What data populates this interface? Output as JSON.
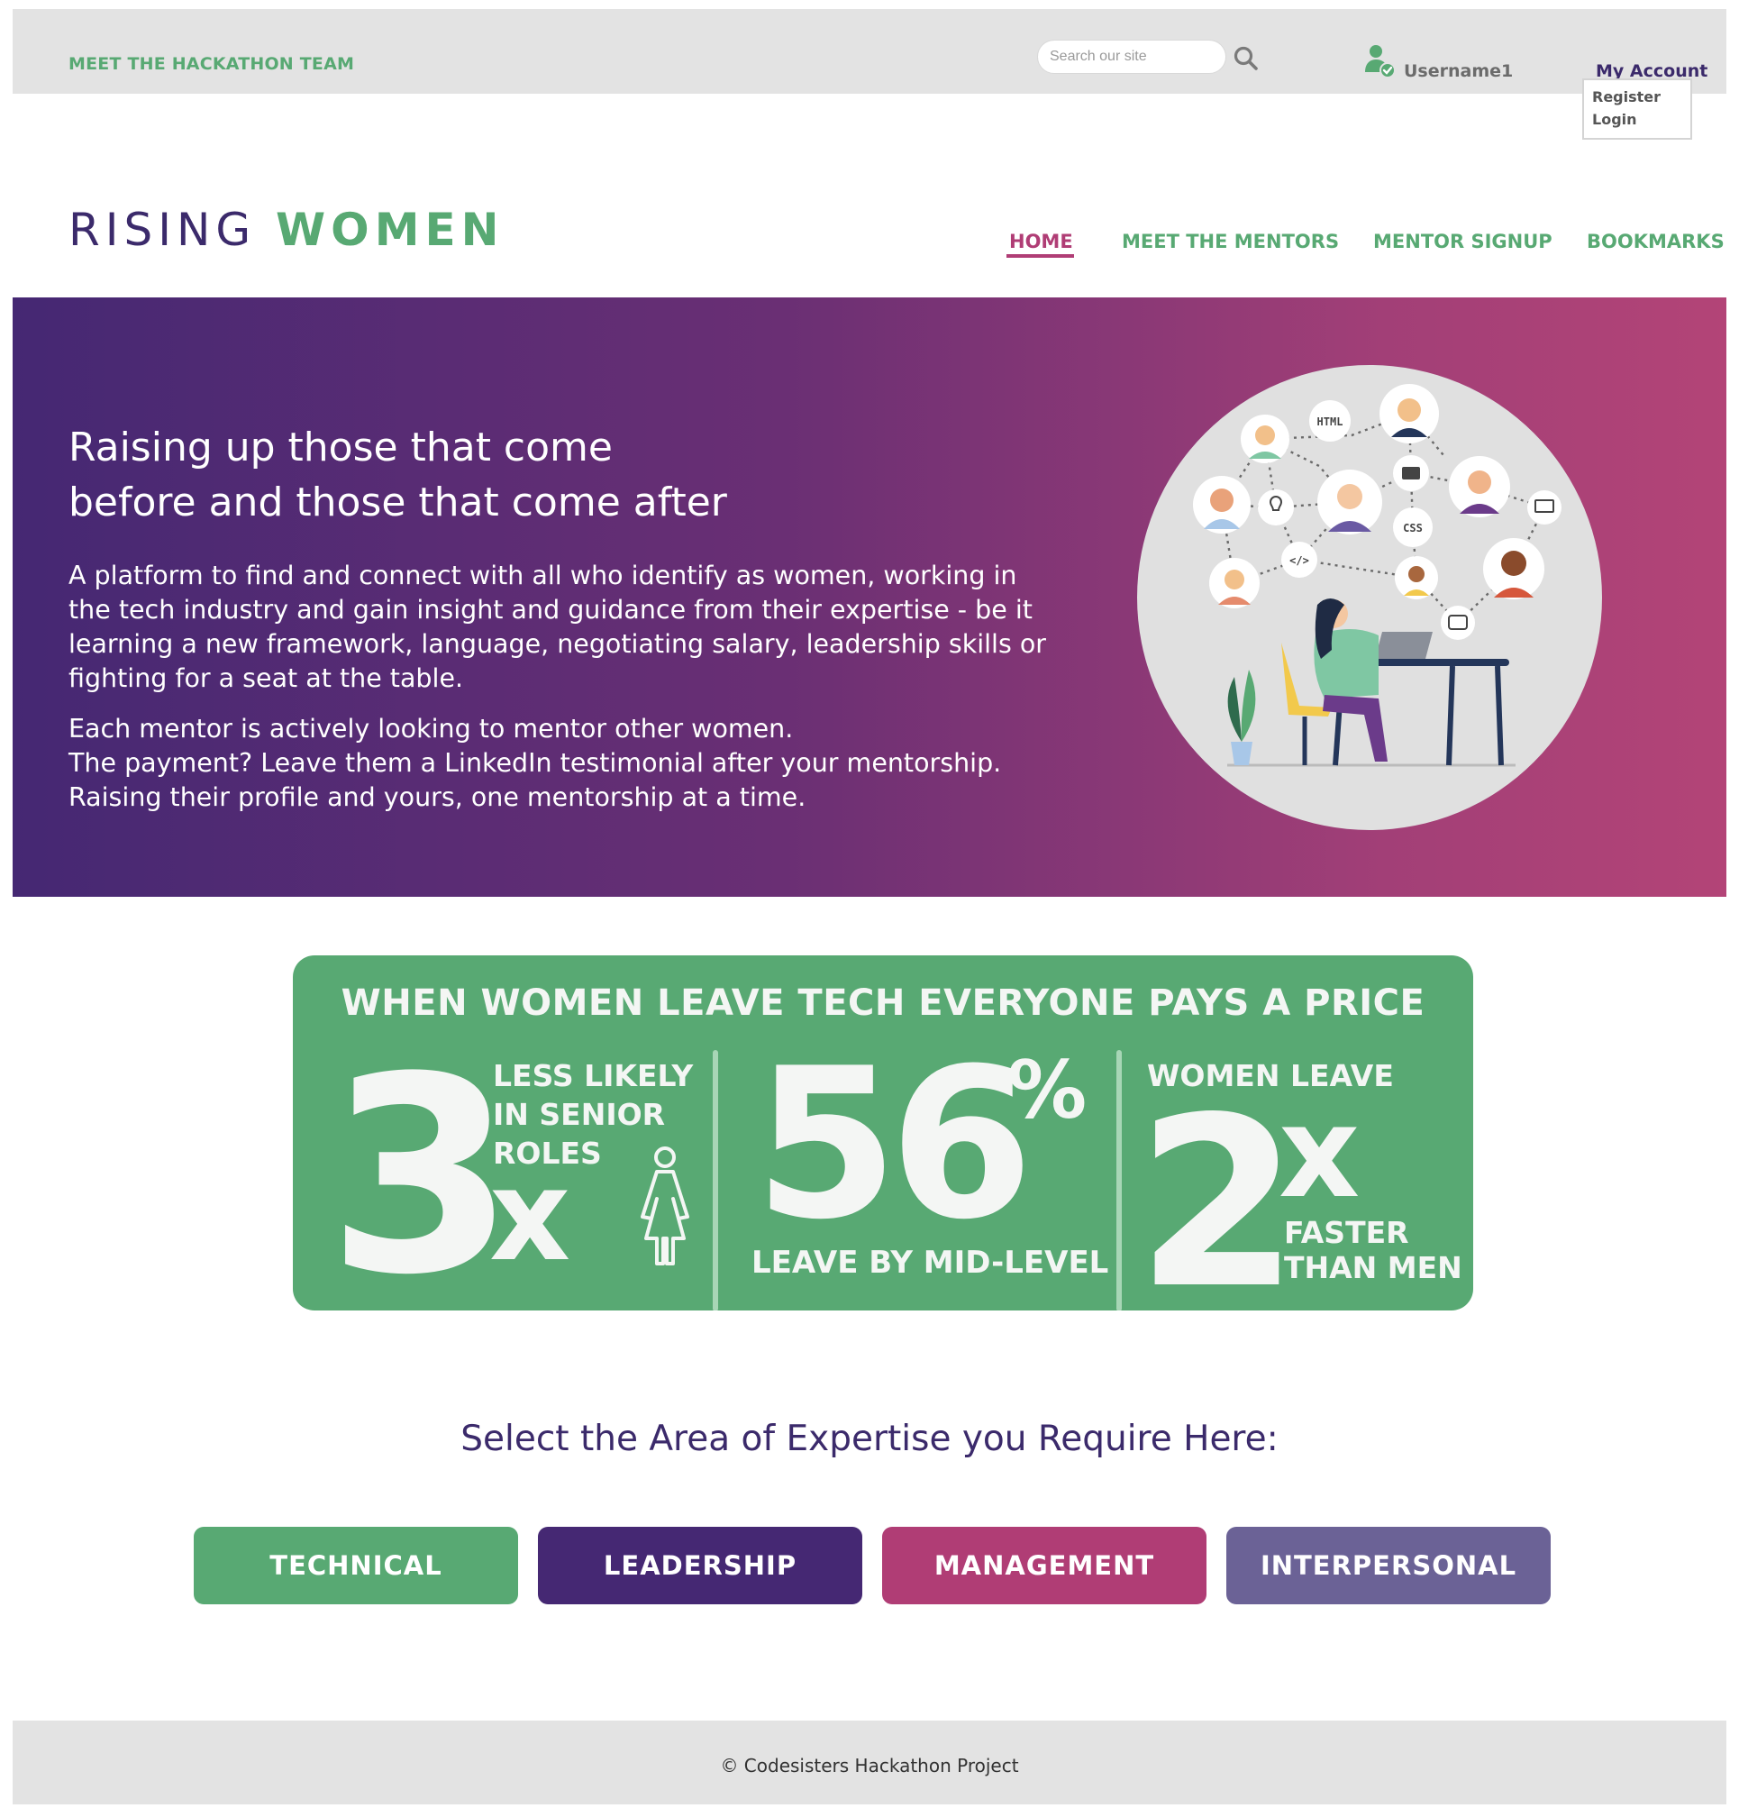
{
  "topbar": {
    "team_link": "MEET THE HACKATHON TEAM",
    "search_placeholder": "Search our site",
    "username": "Username1",
    "account_label": "My Account",
    "account_menu": [
      "Register",
      "Login"
    ]
  },
  "header": {
    "logo_part1": "RISING",
    "logo_part2": "WOMEN",
    "nav": [
      "HOME",
      "MEET THE MENTORS",
      "MENTOR SIGNUP",
      "BOOKMARKS"
    ],
    "active_nav": "HOME"
  },
  "hero": {
    "title_line1": "Raising up those that come",
    "title_line2": "before and those that come after",
    "paragraph1": "A platform to find and connect with all who identify as women, working in the tech industry and gain insight and guidance from their expertise - be it learning a new framework, language, negotiating salary, leadership skills or fighting for a seat at the table.",
    "paragraph2": "Each mentor is actively looking to mentor other women.\nThe payment? Leave them a LinkedIn testimonial after your mentorship.\nRaising their profile and yours, one mentorship at a time.",
    "illustration_tags": [
      "HTML",
      "CSS",
      "</>"
    ]
  },
  "stats": {
    "title": "WHEN WOMEN LEAVE TECH EVERYONE PAYS A PRICE",
    "stat1": {
      "number": "3",
      "suffix": "x",
      "line1": "LESS LIKELY",
      "line2": "IN SENIOR",
      "line3": "ROLES"
    },
    "stat2": {
      "number": "56",
      "suffix": "%",
      "label": "LEAVE BY MID-LEVEL"
    },
    "stat3": {
      "top": "WOMEN LEAVE",
      "number": "2",
      "suffix": "x",
      "line1": "FASTER",
      "line2": "THAN MEN"
    }
  },
  "expertise": {
    "heading": "Select the Area of Expertise you Require Here:",
    "buttons": [
      {
        "label": "TECHNICAL",
        "color": "#58a973"
      },
      {
        "label": "LEADERSHIP",
        "color": "#452873"
      },
      {
        "label": "MANAGEMENT",
        "color": "#b03d75"
      },
      {
        "label": "INTERPERSONAL",
        "color": "#6b6296"
      }
    ]
  },
  "footer": {
    "text": "© Codesisters Hackathon Project"
  },
  "colors": {
    "green": "#58a973",
    "purple": "#3b2a6b",
    "magenta": "#b03d75",
    "topbar_gray": "#e3e3e3"
  },
  "icons": [
    "search-icon",
    "user-check-icon",
    "woman-icon"
  ]
}
